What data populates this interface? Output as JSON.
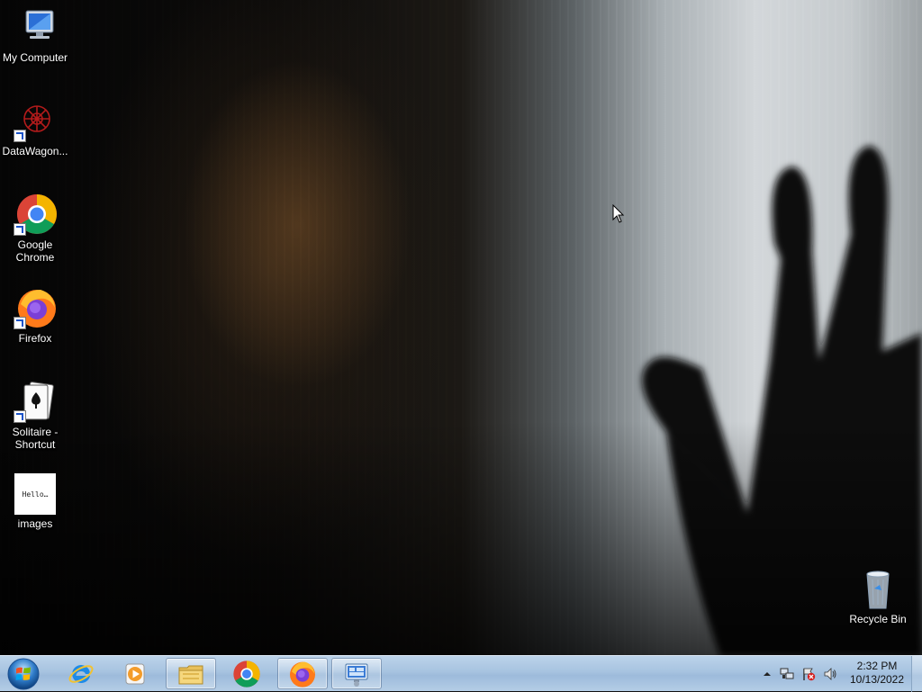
{
  "desktop": {
    "icons": [
      {
        "label": "My Computer",
        "icon": "computer-icon"
      },
      {
        "label": "DataWagon...",
        "icon": "datawagon-icon"
      },
      {
        "label": "Google Chrome",
        "icon": "chrome-icon"
      },
      {
        "label": "Firefox",
        "icon": "firefox-icon"
      },
      {
        "label": "Solitaire - Shortcut",
        "icon": "solitaire-icon"
      },
      {
        "label": "images",
        "icon": "image-file-icon",
        "thumbnail_text": "Hello…"
      },
      {
        "label": "Recycle Bin",
        "icon": "recycle-bin-icon"
      }
    ]
  },
  "taskbar": {
    "start": {
      "icon": "windows-start-orb-icon"
    },
    "pinned": [
      {
        "name": "Internet Explorer",
        "icon": "ie-icon",
        "open": false
      },
      {
        "name": "Windows Media Player",
        "icon": "media-player-icon",
        "open": false
      },
      {
        "name": "Windows Explorer",
        "icon": "folder-icon",
        "open": true
      },
      {
        "name": "Google Chrome",
        "icon": "chrome-icon",
        "open": false
      },
      {
        "name": "Firefox",
        "icon": "firefox-icon",
        "open": true
      },
      {
        "name": "Remote Desktop",
        "icon": "remote-desktop-icon",
        "open": true
      }
    ],
    "tray": {
      "icons": [
        "show-hidden-icons-arrow",
        "network-icon",
        "action-center-flag-icon",
        "volume-icon"
      ],
      "time": "2:32 PM",
      "date": "10/13/2022"
    }
  },
  "colors": {
    "taskbar": "#a7c3e0",
    "icon_label": "#ffffff"
  }
}
